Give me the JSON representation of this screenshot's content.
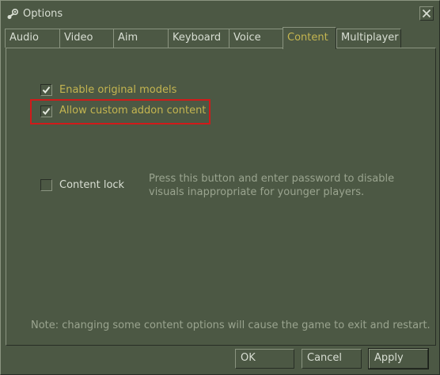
{
  "window": {
    "title": "Options",
    "icon": "steam-icon",
    "close_icon": "close-icon"
  },
  "tabs": [
    {
      "label": "Audio",
      "active": false
    },
    {
      "label": "Video",
      "active": false
    },
    {
      "label": "Aim",
      "active": false
    },
    {
      "label": "Keyboard",
      "active": false
    },
    {
      "label": "Voice",
      "active": false
    },
    {
      "label": "Content",
      "active": true
    },
    {
      "label": "Multiplayer",
      "active": false
    }
  ],
  "content": {
    "options": [
      {
        "label": "Enable original models",
        "checked": true
      },
      {
        "label": "Allow custom addon content",
        "checked": true,
        "highlighted": true
      }
    ],
    "content_lock": {
      "label": "Content lock",
      "checked": false,
      "description": "Press this button and enter password to disable visuals inappropriate for younger players."
    },
    "note": "Note: changing some content options will cause the game to exit and restart."
  },
  "buttons": {
    "ok": "OK",
    "cancel": "Cancel",
    "apply": "Apply"
  },
  "colors": {
    "background": "#4c5844",
    "accent_text": "#c4b550",
    "text": "#d8ded3",
    "muted_text": "#9aa48f",
    "highlight": "#d11a1a"
  }
}
